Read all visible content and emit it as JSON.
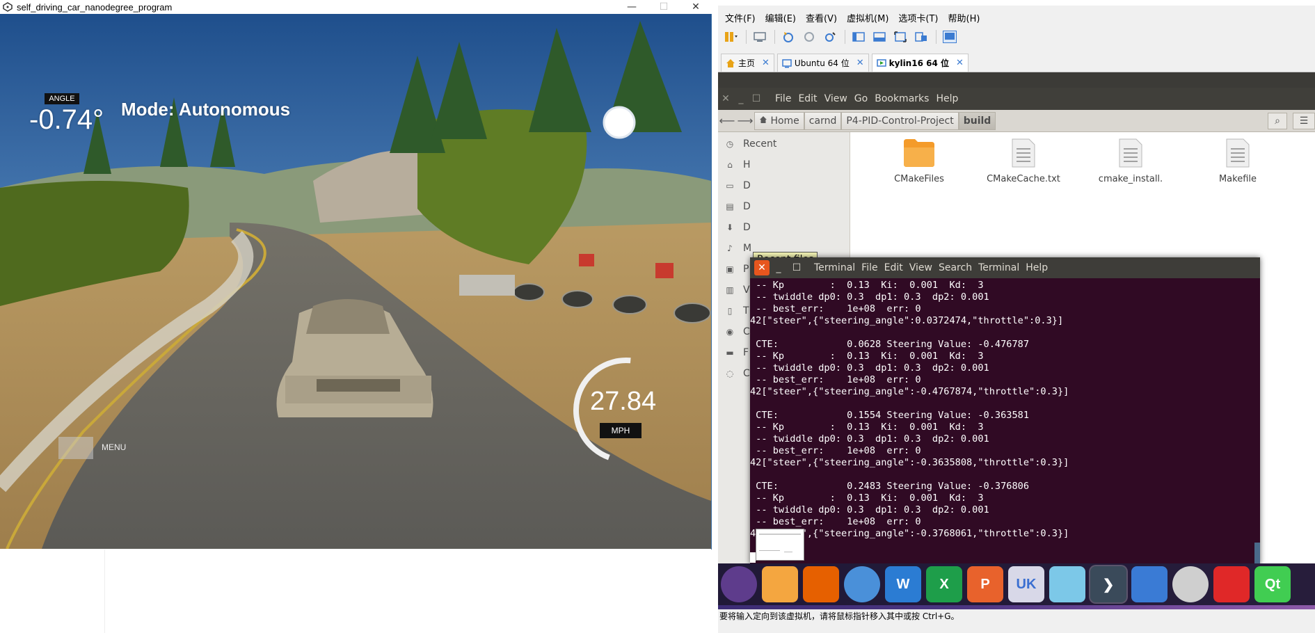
{
  "sim": {
    "window_title": "self_driving_car_nanodegree_program",
    "controls": {
      "minimize": "—",
      "maximize": "☐",
      "close": "✕"
    },
    "hud": {
      "angle_label": "ANGLE",
      "angle_value": "-0.74°",
      "mode": "Mode: Autonomous",
      "speed": "27.84",
      "speed_unit": "MPH",
      "speed_gauge_fraction": 0.55,
      "menu_label": "MENU"
    }
  },
  "vm": {
    "menu": [
      "文件(F)",
      "编辑(E)",
      "查看(V)",
      "虚拟机(M)",
      "选项卡(T)",
      "帮助(H)"
    ],
    "tabs": [
      {
        "label": "主页",
        "icon": "home-icon",
        "close": "✕",
        "active": false
      },
      {
        "label": "Ubuntu 64 位",
        "icon": "vm-icon",
        "close": "✕",
        "active": false
      },
      {
        "label": "kylin16 64 位",
        "icon": "vm-running-icon",
        "close": "✕",
        "active": true
      }
    ],
    "status_text": "要将输入定向到该虚拟机，请将鼠标指针移入其中或按 Ctrl+G。"
  },
  "nautilus": {
    "menu": [
      "File",
      "Edit",
      "View",
      "Go",
      "Bookmarks",
      "Help"
    ],
    "path": [
      "Home",
      "carnd",
      "P4-PID-Control-Project",
      "build"
    ],
    "sidebar": [
      {
        "label": "Recent",
        "icon": "clock-icon"
      },
      {
        "label": "H",
        "icon": "home-icon"
      },
      {
        "label": "D",
        "icon": "desktop-icon"
      },
      {
        "label": "D",
        "icon": "document-icon"
      },
      {
        "label": "D",
        "icon": "download-icon"
      },
      {
        "label": "M",
        "icon": "music-icon"
      },
      {
        "label": "P",
        "icon": "picture-icon"
      },
      {
        "label": "V",
        "icon": "video-icon"
      },
      {
        "label": "T",
        "icon": "trash-icon"
      },
      {
        "label": "C",
        "icon": "computer-icon"
      },
      {
        "label": "F",
        "icon": "folder-icon"
      },
      {
        "label": "C",
        "icon": "network-icon"
      }
    ],
    "tooltip": "Recent files",
    "files": [
      {
        "name": "CMakeFiles",
        "type": "folder"
      },
      {
        "name": "CMakeCache.txt",
        "type": "text"
      },
      {
        "name": "cmake_install.",
        "type": "text"
      },
      {
        "name": "Makefile",
        "type": "text"
      }
    ]
  },
  "terminal": {
    "menu": [
      "Terminal",
      "File",
      "Edit",
      "View",
      "Search",
      "Terminal",
      "Help"
    ],
    "lines": [
      " -- Kp        :  0.13  Ki:  0.001  Kd:  3",
      " -- twiddle dp0: 0.3  dp1: 0.3  dp2: 0.001",
      " -- best_err:    1e+08  err: 0",
      "42[\"steer\",{\"steering_angle\":0.0372474,\"throttle\":0.3}]",
      "",
      " CTE:            0.0628 Steering Value: -0.476787",
      " -- Kp        :  0.13  Ki:  0.001  Kd:  3",
      " -- twiddle dp0: 0.3  dp1: 0.3  dp2: 0.001",
      " -- best_err:    1e+08  err: 0",
      "42[\"steer\",{\"steering_angle\":-0.4767874,\"throttle\":0.3}]",
      "",
      " CTE:            0.1554 Steering Value: -0.363581",
      " -- Kp        :  0.13  Ki:  0.001  Kd:  3",
      " -- twiddle dp0: 0.3  dp1: 0.3  dp2: 0.001",
      " -- best_err:    1e+08  err: 0",
      "42[\"steer\",{\"steering_angle\":-0.3635808,\"throttle\":0.3}]",
      "",
      " CTE:            0.2483 Steering Value: -0.376806",
      " -- Kp        :  0.13  Ki:  0.001  Kd:  3",
      " -- twiddle dp0: 0.3  dp1: 0.3  dp2: 0.001",
      " -- best_err:    1e+08  err: 0",
      "42[\"steer\",{\"steering_angle\":-0.3768061,\"throttle\":0.3}]"
    ]
  },
  "dock": [
    {
      "name": "ubuntu-kylin-icon",
      "color": "#5e3c8c",
      "glyph": ""
    },
    {
      "name": "files-icon",
      "color": "#f4a640",
      "glyph": ""
    },
    {
      "name": "firefox-icon",
      "color": "#e66000",
      "glyph": ""
    },
    {
      "name": "browser-icon",
      "color": "#4a90d9",
      "glyph": ""
    },
    {
      "name": "wps-writer-icon",
      "color": "#2b7cd3",
      "glyph": "W"
    },
    {
      "name": "wps-spreadsheet-icon",
      "color": "#1e9e4a",
      "glyph": "X"
    },
    {
      "name": "wps-presentation-icon",
      "color": "#e8622c",
      "glyph": "P"
    },
    {
      "name": "software-center-icon",
      "color": "#d8d8e8",
      "glyph": "UK"
    },
    {
      "name": "network-icon",
      "color": "#7cc8e8",
      "glyph": ""
    },
    {
      "name": "terminal-icon",
      "color": "#3a4a5a",
      "glyph": "❯"
    },
    {
      "name": "window-icon",
      "color": "#3a7bd5",
      "glyph": ""
    },
    {
      "name": "camera-icon",
      "color": "#cfcfcf",
      "glyph": ""
    },
    {
      "name": "chinese-input-icon",
      "color": "#e02828",
      "glyph": ""
    },
    {
      "name": "qt-icon",
      "color": "#41cd52",
      "glyph": "Qt"
    }
  ]
}
